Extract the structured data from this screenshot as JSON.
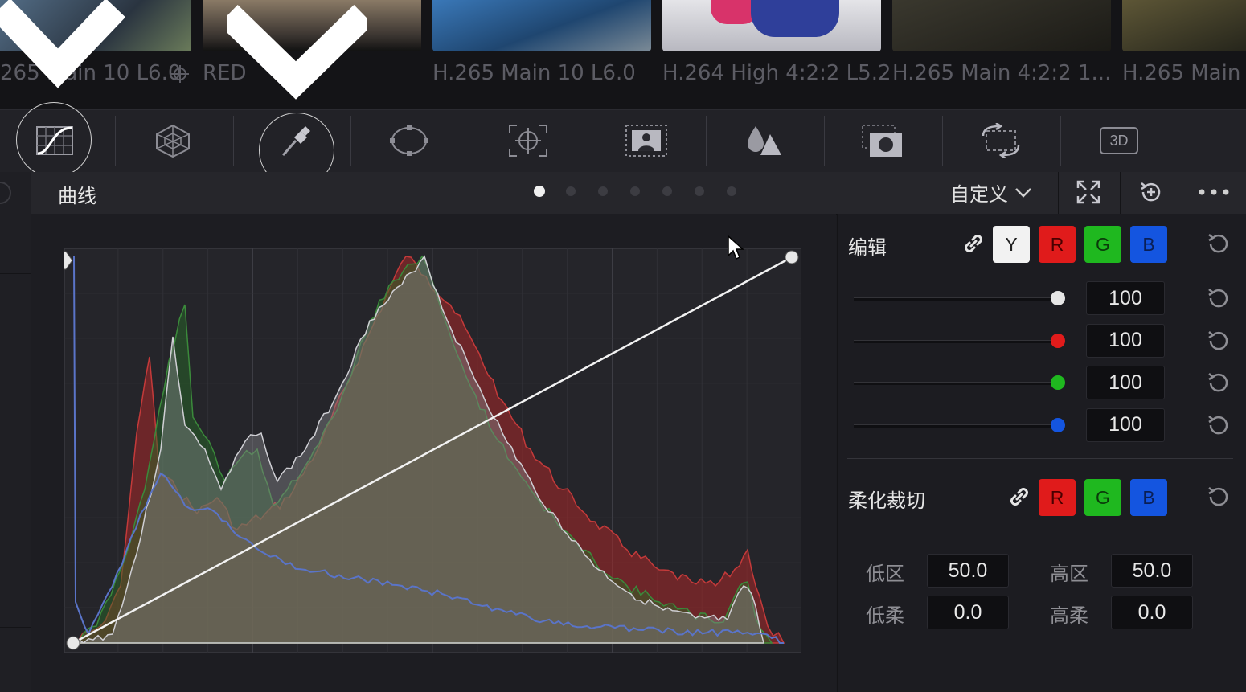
{
  "clips": [
    {
      "codec": "265 Main 10 L6.0",
      "thumb_color": "#3a4d5e"
    },
    {
      "codec": "RED",
      "thumb_color": "#4a4036"
    },
    {
      "codec": "H.265 Main 10 L6.0",
      "thumb_color": "#2f5b86"
    },
    {
      "codec": "H.264 High 4:2:2 L5.2",
      "thumb_color": "#c9c9cf"
    },
    {
      "codec": "H.265 Main 4:2:2 1...",
      "thumb_color": "#2b2a24"
    },
    {
      "codec": "H.265 Main",
      "thumb_color": "#3d3a28"
    }
  ],
  "palette_tools": [
    {
      "name": "curves-icon",
      "active": true
    },
    {
      "name": "color-warper-icon",
      "active": false
    },
    {
      "name": "qualifier-eyedropper-icon",
      "active": true
    },
    {
      "name": "power-window-icon",
      "active": false
    },
    {
      "name": "tracker-icon",
      "active": false
    },
    {
      "name": "magic-mask-icon",
      "active": false
    },
    {
      "name": "blur-icon",
      "active": false
    },
    {
      "name": "key-icon",
      "active": false
    },
    {
      "name": "sizing-icon",
      "active": false
    },
    {
      "name": "3d-icon",
      "active": false,
      "label": "3D"
    }
  ],
  "curves_panel": {
    "title": "曲线",
    "page_count": 7,
    "active_page": 0,
    "mode_label": "自定义"
  },
  "edit": {
    "label": "编辑",
    "channels": [
      {
        "key": "Y",
        "bg": "#f2f2f2",
        "fg": "#222222"
      },
      {
        "key": "R",
        "bg": "#e01b1b",
        "fg": "#4a0000"
      },
      {
        "key": "G",
        "bg": "#1fb81f",
        "fg": "#0a3a0a"
      },
      {
        "key": "B",
        "bg": "#1455e0",
        "fg": "#0a1f55"
      }
    ],
    "intensity": [
      {
        "channel": "Y",
        "value": "100",
        "knob_color": "#e6e6e6",
        "level": 1.0
      },
      {
        "channel": "R",
        "value": "100",
        "knob_color": "#e01b1b",
        "level": 1.0
      },
      {
        "channel": "G",
        "value": "100",
        "knob_color": "#1fb81f",
        "level": 1.0
      },
      {
        "channel": "B",
        "value": "100",
        "knob_color": "#1455e0",
        "level": 1.0
      }
    ]
  },
  "soft_clip": {
    "label": "柔化裁切",
    "channels": [
      {
        "key": "R",
        "bg": "#e01b1b",
        "fg": "#4a0000"
      },
      {
        "key": "G",
        "bg": "#1fb81f",
        "fg": "#0a3a0a"
      },
      {
        "key": "B",
        "bg": "#1455e0",
        "fg": "#0a1f55"
      }
    ],
    "low_label": "低区",
    "low_value": "50.0",
    "high_label": "高区",
    "high_value": "50.0",
    "low_soft_label": "低柔",
    "low_soft_value": "0.0",
    "high_soft_label": "高柔",
    "high_soft_value": "0.0"
  },
  "curve": {
    "points": [
      [
        0,
        0
      ],
      [
        1,
        1
      ]
    ]
  }
}
